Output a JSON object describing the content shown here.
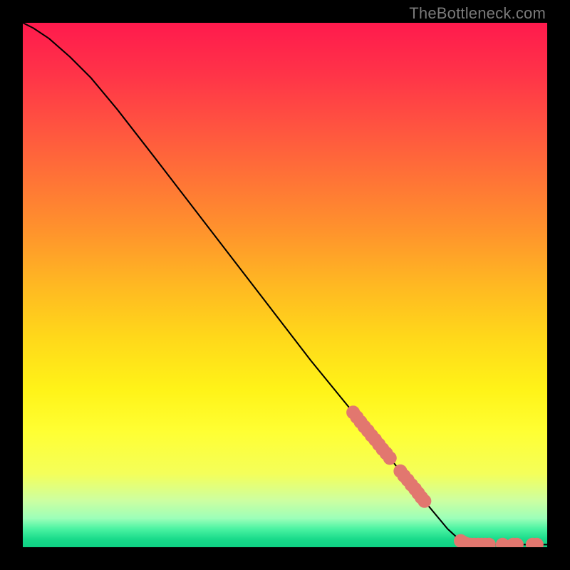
{
  "watermark": "TheBottleneck.com",
  "chart_data": {
    "type": "line",
    "title": "",
    "xlabel": "",
    "ylabel": "",
    "xlim": [
      0,
      100
    ],
    "ylim": [
      0,
      100
    ],
    "grid": false,
    "background_gradient": {
      "stops": [
        {
          "offset": 0.0,
          "color": "#ff1a4d"
        },
        {
          "offset": 0.1,
          "color": "#ff3448"
        },
        {
          "offset": 0.2,
          "color": "#ff5440"
        },
        {
          "offset": 0.3,
          "color": "#ff7436"
        },
        {
          "offset": 0.4,
          "color": "#ff942c"
        },
        {
          "offset": 0.5,
          "color": "#ffb822"
        },
        {
          "offset": 0.6,
          "color": "#ffd81a"
        },
        {
          "offset": 0.7,
          "color": "#fff318"
        },
        {
          "offset": 0.78,
          "color": "#ffff33"
        },
        {
          "offset": 0.86,
          "color": "#f4ff5a"
        },
        {
          "offset": 0.91,
          "color": "#ceffa0"
        },
        {
          "offset": 0.945,
          "color": "#9cffb9"
        },
        {
          "offset": 0.965,
          "color": "#4bf3a2"
        },
        {
          "offset": 0.985,
          "color": "#18da8a"
        },
        {
          "offset": 1.0,
          "color": "#0fd184"
        }
      ]
    },
    "curve": {
      "points": [
        {
          "x": 0.0,
          "y": 100.0
        },
        {
          "x": 2.0,
          "y": 99.0
        },
        {
          "x": 5.0,
          "y": 97.0
        },
        {
          "x": 9.0,
          "y": 93.5
        },
        {
          "x": 13.0,
          "y": 89.5
        },
        {
          "x": 18.0,
          "y": 83.5
        },
        {
          "x": 25.0,
          "y": 74.5
        },
        {
          "x": 35.0,
          "y": 61.5
        },
        {
          "x": 45.0,
          "y": 48.5
        },
        {
          "x": 55.0,
          "y": 35.5
        },
        {
          "x": 63.0,
          "y": 25.7
        },
        {
          "x": 70.0,
          "y": 17.0
        },
        {
          "x": 76.0,
          "y": 9.5
        },
        {
          "x": 81.0,
          "y": 3.5
        },
        {
          "x": 83.5,
          "y": 1.2
        },
        {
          "x": 85.0,
          "y": 0.5
        },
        {
          "x": 90.0,
          "y": 0.5
        },
        {
          "x": 95.0,
          "y": 0.5
        },
        {
          "x": 100.0,
          "y": 0.5
        }
      ]
    },
    "markers": {
      "color": "#e2776f",
      "radius": 1.3,
      "points": [
        {
          "x": 63.0,
          "y": 25.7
        },
        {
          "x": 63.7,
          "y": 24.8
        },
        {
          "x": 64.4,
          "y": 23.9
        },
        {
          "x": 65.1,
          "y": 23.0
        },
        {
          "x": 65.8,
          "y": 22.2
        },
        {
          "x": 66.5,
          "y": 21.3
        },
        {
          "x": 67.2,
          "y": 20.5
        },
        {
          "x": 67.9,
          "y": 19.6
        },
        {
          "x": 68.6,
          "y": 18.7
        },
        {
          "x": 69.3,
          "y": 17.9
        },
        {
          "x": 70.0,
          "y": 17.0
        },
        {
          "x": 72.0,
          "y": 14.5
        },
        {
          "x": 72.7,
          "y": 13.6
        },
        {
          "x": 73.4,
          "y": 12.8
        },
        {
          "x": 74.1,
          "y": 11.9
        },
        {
          "x": 74.8,
          "y": 11.1
        },
        {
          "x": 75.4,
          "y": 10.3
        },
        {
          "x": 76.0,
          "y": 9.5
        },
        {
          "x": 76.6,
          "y": 8.8
        },
        {
          "x": 83.5,
          "y": 1.2
        },
        {
          "x": 84.0,
          "y": 0.9
        },
        {
          "x": 84.7,
          "y": 0.6
        },
        {
          "x": 85.4,
          "y": 0.5
        },
        {
          "x": 86.1,
          "y": 0.5
        },
        {
          "x": 86.8,
          "y": 0.5
        },
        {
          "x": 87.5,
          "y": 0.5
        },
        {
          "x": 88.2,
          "y": 0.5
        },
        {
          "x": 88.9,
          "y": 0.5
        },
        {
          "x": 91.5,
          "y": 0.5
        },
        {
          "x": 93.5,
          "y": 0.5
        },
        {
          "x": 94.2,
          "y": 0.5
        },
        {
          "x": 97.2,
          "y": 0.5
        },
        {
          "x": 98.0,
          "y": 0.5
        }
      ]
    }
  }
}
